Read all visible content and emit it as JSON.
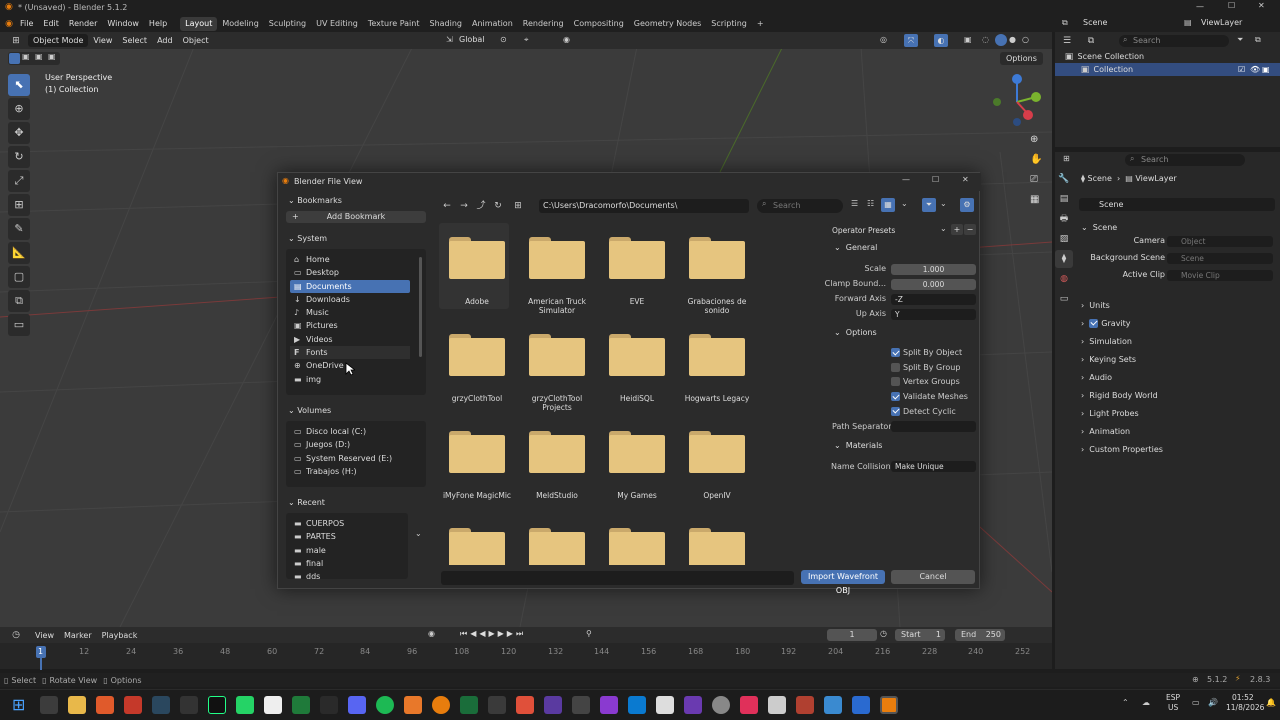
{
  "titlebar": {
    "title": "* (Unsaved) - Blender 5.1.2"
  },
  "menus": [
    "File",
    "Edit",
    "Render",
    "Window",
    "Help"
  ],
  "workspaces": [
    "Layout",
    "Modeling",
    "Sculpting",
    "UV Editing",
    "Texture Paint",
    "Shading",
    "Animation",
    "Rendering",
    "Compositing",
    "Geometry Nodes",
    "Scripting"
  ],
  "scene": {
    "name": "Scene",
    "view_layer": "ViewLayer"
  },
  "viewport": {
    "mode": "Object Mode",
    "menus": [
      "View",
      "Select",
      "Add",
      "Object"
    ],
    "orientation": "Global",
    "options_label": "Options",
    "overlay_line1": "User Perspective",
    "overlay_line2": "(1) Collection"
  },
  "outliner": {
    "search_placeholder": "Search",
    "items": [
      "Scene Collection",
      "Collection"
    ]
  },
  "properties": {
    "search_placeholder": "Search",
    "breadcrumb": [
      "Scene",
      "ViewLayer"
    ],
    "scene_field": "Scene",
    "scene_panel": "Scene",
    "camera_label": "Camera",
    "camera_placeholder": "Object",
    "bg_label": "Background Scene",
    "bg_placeholder": "Scene",
    "clip_label": "Active Clip",
    "clip_placeholder": "Movie Clip",
    "panels": [
      "Units",
      "Gravity",
      "Simulation",
      "Keying Sets",
      "Audio",
      "Rigid Body World",
      "Light Probes",
      "Animation",
      "Custom Properties"
    ]
  },
  "dialog": {
    "title": "Blender File View",
    "path": "C:\\Users\\Dracomorfo\\Documents\\",
    "search_placeholder": "Search",
    "bookmarks_label": "Bookmarks",
    "add_bookmark": "Add Bookmark",
    "system_label": "System",
    "system_items": [
      "Home",
      "Desktop",
      "Documents",
      "Downloads",
      "Music",
      "Pictures",
      "Videos",
      "Fonts",
      "OneDrive",
      "img"
    ],
    "volumes_label": "Volumes",
    "volume_items": [
      "Disco local (C:)",
      "Juegos (D:)",
      "System Reserved (E:)",
      "Trabajos (H:)"
    ],
    "recent_label": "Recent",
    "recent_items": [
      "CUERPOS",
      "PARTES",
      "male",
      "final",
      "dds"
    ],
    "folders": [
      "Adobe",
      "American Truck Simulator",
      "EVE",
      "Grabaciones de sonido",
      "grzyClothTool",
      "grzyClothTool Projects",
      "HeidiSQL",
      "Hogwarts Legacy",
      "iMyFone MagicMic",
      "MeldStudio",
      "My Games",
      "OpenIV",
      "",
      "",
      "",
      ""
    ],
    "operator_presets": "Operator Presets",
    "general_label": "General",
    "scale_label": "Scale",
    "scale_value": "1.000",
    "clamp_label": "Clamp Bound...",
    "clamp_value": "0.000",
    "forward_label": "Forward Axis",
    "forward_value": "-Z",
    "up_label": "Up Axis",
    "up_value": "Y",
    "options_label": "Options",
    "options": [
      {
        "label": "Split By Object",
        "checked": true
      },
      {
        "label": "Split By Group",
        "checked": false
      },
      {
        "label": "Vertex Groups",
        "checked": false
      },
      {
        "label": "Validate Meshes",
        "checked": true
      },
      {
        "label": "Detect Cyclic Curv...",
        "checked": true
      }
    ],
    "path_sep_label": "Path Separator",
    "materials_label": "Materials",
    "name_collision_label": "Name Collision",
    "name_collision_value": "Make Unique",
    "import_label": "Import Wavefront OBJ",
    "cancel_label": "Cancel"
  },
  "timeline": {
    "menus": [
      "View",
      "Marker",
      "Playback"
    ],
    "current_frame": "1",
    "start_label": "Start",
    "start_value": "1",
    "end_label": "End",
    "end_value": "250",
    "ticks": [
      "1",
      "12",
      "24",
      "36",
      "48",
      "60",
      "72",
      "84",
      "96",
      "108",
      "120",
      "132",
      "144",
      "156",
      "168",
      "180",
      "192",
      "204",
      "216",
      "228",
      "240",
      "252"
    ]
  },
  "statusbar": {
    "select": "Select",
    "rotate": "Rotate View",
    "options": "Options",
    "version": "5.1.2",
    "version2": "2.8.3"
  },
  "taskbar": {
    "lang1": "ESP",
    "lang2": "US",
    "time": "01:52",
    "date": "11/8/2026"
  },
  "colors": {
    "accent": "#4772b3",
    "folder": "#e6c57f",
    "viewport": "#3b3b3b",
    "panel": "#282828"
  }
}
